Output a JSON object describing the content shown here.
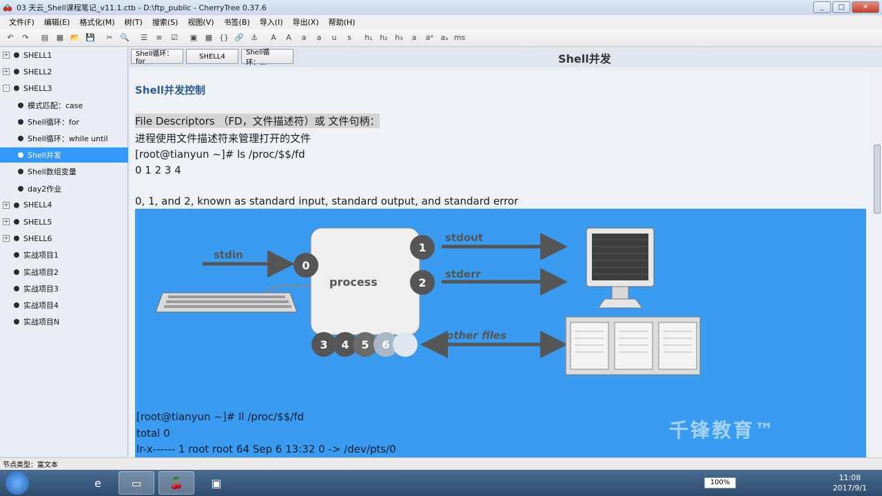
{
  "window": {
    "title": "03 天云_Shell课程笔记_v11.1.ctb - D:\\ftp_public - CherryTree 0.37.6",
    "min_label": "_",
    "max_label": "□",
    "close_label": "✕"
  },
  "menu": [
    "文件(F)",
    "编辑(E)",
    "格式化(M)",
    "树(T)",
    "搜索(S)",
    "视图(V)",
    "书签(B)",
    "导入(I)",
    "导出(X)",
    "帮助(H)"
  ],
  "toolbar_icons": [
    "undo-icon",
    "redo-icon",
    "new-node-icon",
    "new-child-icon",
    "folder-open-icon",
    "save-icon",
    "cut-icon",
    "search-icon",
    "bullet-list-icon",
    "numbered-list-icon",
    "todo-list-icon",
    "image-icon",
    "table-icon",
    "codebox-icon",
    "link-icon",
    "anchor-icon",
    "color-fg-icon",
    "color-bg-icon",
    "bold-icon",
    "italic-icon",
    "underline-icon",
    "strikethrough-icon",
    "h1-icon",
    "h2-icon",
    "h3-icon",
    "small-icon",
    "superscript-icon",
    "subscript-icon",
    "monospace-icon"
  ],
  "toolbar_glyphs": [
    "↶",
    "↷",
    "▤",
    "▦",
    "📂",
    "💾",
    "✂",
    "🔍",
    "☰",
    "≡",
    "☑",
    "▣",
    "▦",
    "{}",
    "🔗",
    "⚓",
    "A",
    "A",
    "a",
    "a",
    "u",
    "s",
    "h₁",
    "h₂",
    "h₃",
    "a",
    "aᵃ",
    "aₐ",
    "ms"
  ],
  "sidebar": {
    "items": [
      {
        "label": "SHELL1",
        "level": 0,
        "expander": "+"
      },
      {
        "label": "SHELL2",
        "level": 0,
        "expander": "+"
      },
      {
        "label": "SHELL3",
        "level": 0,
        "expander": "-"
      },
      {
        "label": "模式匹配：case",
        "level": 1,
        "expander": ""
      },
      {
        "label": "Shell循环：for",
        "level": 1,
        "expander": ""
      },
      {
        "label": "Shell循环：while until",
        "level": 1,
        "expander": ""
      },
      {
        "label": "Shell并发",
        "level": 1,
        "expander": "",
        "selected": true
      },
      {
        "label": "Shell数组变量",
        "level": 1,
        "expander": ""
      },
      {
        "label": "day2作业",
        "level": 1,
        "expander": ""
      },
      {
        "label": "SHELL4",
        "level": 0,
        "expander": "+"
      },
      {
        "label": "SHELL5",
        "level": 0,
        "expander": "+"
      },
      {
        "label": "SHELL6",
        "level": 0,
        "expander": "+"
      },
      {
        "label": "实战项目1",
        "level": 0,
        "expander": ""
      },
      {
        "label": "实战项目2",
        "level": 0,
        "expander": ""
      },
      {
        "label": "实战项目3",
        "level": 0,
        "expander": ""
      },
      {
        "label": "实战项目4",
        "level": 0,
        "expander": ""
      },
      {
        "label": "实战项目N",
        "level": 0,
        "expander": ""
      }
    ]
  },
  "tabs": [
    "Shell循环：for",
    "SHELL4",
    "Shell循环：..."
  ],
  "node_title": "Shell并发",
  "content": {
    "heading": "Shell并发控制",
    "lines": [
      "File Descriptors （FD，文件描述符）或 文件句柄：",
      "进程使用文件描述符来管理打开的文件",
      "[root@tianyun ~]# ls /proc/$$/fd",
      "0  1  2  3  4",
      "0, 1, and 2, known as standard input, standard output, and standard error"
    ],
    "diagram": {
      "stdin": "stdin",
      "process": "process",
      "stdout": "stdout",
      "stderr": "stderr",
      "other": "other files",
      "fd0": "0",
      "fd1": "1",
      "fd2": "2",
      "fd3": "3",
      "fd4": "4",
      "fd5": "5",
      "fd6": "6"
    },
    "after_lines": [
      "[root@tianyun ~]# ll /proc/$$/fd",
      "total 0",
      "lr-x------ 1 root root 64 Sep  6 13:32 0 -> /dev/pts/0"
    ]
  },
  "watermark": "千锋教育™",
  "status": "节点类型：富文本",
  "taskbar": {
    "zoom": "100%",
    "time": "11:08",
    "date": "2017/9/1"
  }
}
